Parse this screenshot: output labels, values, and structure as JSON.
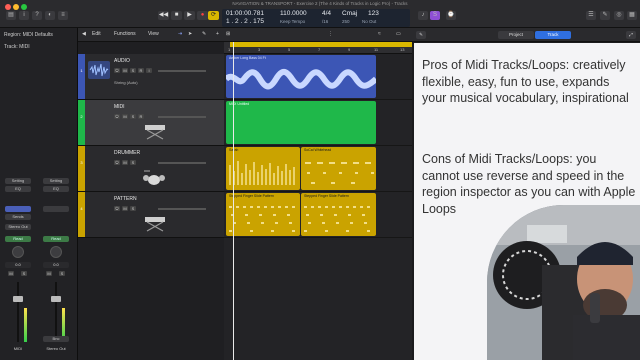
{
  "window": {
    "title": "NAVIGATION & TRANSPORT - Exercise 2 (The 4 Kinds of Tracks in Logic Pro) - Tracks"
  },
  "lcd": {
    "time": "01:00:00.781",
    "tempo": "110.0000",
    "signature": "4/4",
    "key": "Cmaj",
    "position": "1 . 2 . 2 . 175",
    "tempo_mode": "Keep Tempo",
    "division": "/16",
    "cpu": "250",
    "output": "No Out",
    "number": "123"
  },
  "inspector": {
    "region": "Region: MIDI Defaults",
    "track": "Track: MIDI",
    "strip1": {
      "setting": "Setting",
      "eq": "EQ",
      "sends": "Sends",
      "output": "Stereo Out",
      "read": "Read",
      "value": "0.0",
      "mute": "M",
      "solo": "S",
      "name": "MIDI"
    },
    "strip2": {
      "setting": "Setting",
      "eq": "EQ",
      "sends": "Sends",
      "output": "",
      "read": "Read",
      "value": "0.0",
      "mute": "M",
      "solo": "S",
      "name": "Stereo Out",
      "bounce": "Bnc"
    }
  },
  "tracks_menu": {
    "edit": "Edit",
    "functions": "Functions",
    "view": "View"
  },
  "tracks": [
    {
      "number": "1",
      "name": "AUDIO",
      "sub": "Shring (Auto)",
      "color": "#3c56b5"
    },
    {
      "number": "2",
      "name": "MIDI",
      "sub": "",
      "color": "#1fb84a"
    },
    {
      "number": "3",
      "name": "DRUMMER",
      "sub": "",
      "color": "#caa300"
    },
    {
      "number": "4",
      "name": "PATTERN",
      "sub": "",
      "color": "#caa300"
    }
  ],
  "ruler": [
    "1",
    "3",
    "5",
    "7",
    "9",
    "11",
    "13"
  ],
  "regions": {
    "audio": "Amber Long Bass 04 Ft",
    "midi": "MIDI Untitled",
    "drummer1": "Sarah",
    "drummer2": "SoCal Whitehead",
    "pattern1": "Stepped Finger Slide Pattern",
    "pattern2": "Stepped Finger Slide Pattern"
  },
  "right_panel": {
    "tab_project": "Project",
    "tab_track": "Track",
    "pros": "Pros of Midi Tracks/Loops: creatively flexible, easy, fun to use, expands your musical vocabulary, inspirational",
    "cons": "Cons of Midi Tracks/Loops: you cannot use reverse and speed in the region inspector as you can with Apple Loops"
  },
  "colors": {
    "audio_region": "#3c56b5",
    "midi_region": "#1fb84a",
    "drummer_region": "#caa300",
    "cycle": "#d9b700"
  }
}
